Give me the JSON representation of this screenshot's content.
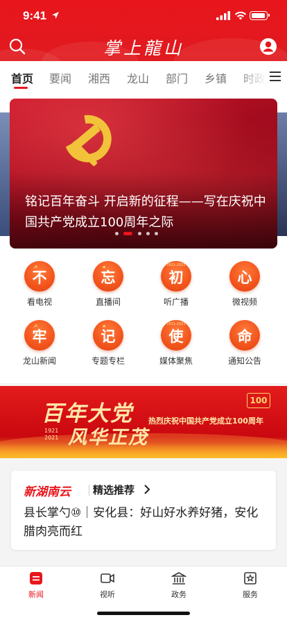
{
  "status": {
    "time": "9:41"
  },
  "header": {
    "logo_text": "掌上龍山",
    "search_icon": "search-icon",
    "user_icon": "user-icon"
  },
  "tabs": [
    {
      "label": "首页",
      "active": true
    },
    {
      "label": "要闻"
    },
    {
      "label": "湘西"
    },
    {
      "label": "龙山"
    },
    {
      "label": "部门"
    },
    {
      "label": "乡镇"
    },
    {
      "label": "时政"
    }
  ],
  "banner": {
    "title": "铭记百年奋斗 开启新的征程——写在庆祝中国共产党成立100周年之际",
    "slide_count": 5,
    "active_slide": 1
  },
  "grid": [
    {
      "char": "不",
      "label": "看电视",
      "badge": "hammer-sickle"
    },
    {
      "char": "忘",
      "label": "直播间",
      "badge": "star"
    },
    {
      "char": "初",
      "label": "听广播",
      "badge": "1921-2021"
    },
    {
      "char": "心",
      "label": "微视频",
      "badge": "arc"
    },
    {
      "char": "牢",
      "label": "龙山新闻",
      "badge": "hammer-sickle"
    },
    {
      "char": "记",
      "label": "专题专栏",
      "badge": "star"
    },
    {
      "char": "使",
      "label": "媒体聚焦",
      "badge": "1921-2021"
    },
    {
      "char": "命",
      "label": "通知公告",
      "badge": "arc"
    }
  ],
  "grid_year_text": "1921-2021",
  "promo": {
    "main": "百年大党",
    "sub": "风华正茂",
    "years_top": "1921",
    "years_bottom": "2021",
    "caption": "热烈庆祝中国共产党成立100周年",
    "badge": "100"
  },
  "recommend": {
    "brand": "新湖南云",
    "label": "精选推荐",
    "article": "县长掌勺⑩｜安化县：好山好水养好猪，安化腊肉亮而红"
  },
  "bottom_nav": [
    {
      "label": "新闻",
      "icon": "news-icon",
      "active": true
    },
    {
      "label": "视听",
      "icon": "video-icon"
    },
    {
      "label": "政务",
      "icon": "government-icon"
    },
    {
      "label": "服务",
      "icon": "service-icon"
    }
  ],
  "colors": {
    "accent": "#e8161c",
    "icon_orange": "#f2541c"
  }
}
